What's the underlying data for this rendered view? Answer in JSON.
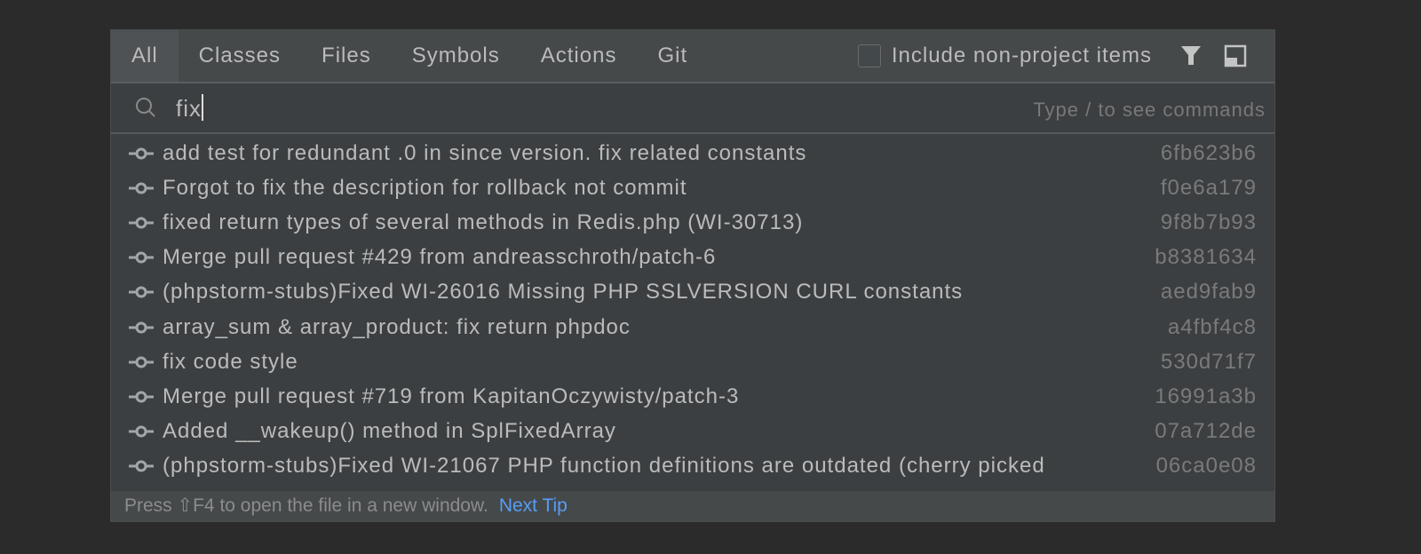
{
  "tabs": [
    {
      "label": "All",
      "selected": true
    },
    {
      "label": "Classes"
    },
    {
      "label": "Files"
    },
    {
      "label": "Symbols"
    },
    {
      "label": "Actions"
    },
    {
      "label": "Git"
    }
  ],
  "options": {
    "include_label": "Include non-project items",
    "include_checked": false,
    "filter_icon": "filter-icon",
    "pin_icon": "open-in-window-icon"
  },
  "search": {
    "value": "fix",
    "hint": "Type / to see commands",
    "icon": "search-icon"
  },
  "results": [
    {
      "message": "add test for redundant .0 in since version. fix related constants",
      "hash": "6fb623b6"
    },
    {
      "message": "Forgot to fix the description for rollback not commit",
      "hash": "f0e6a179"
    },
    {
      "message": "fixed return types of several methods in Redis.php (WI-30713)",
      "hash": "9f8b7b93"
    },
    {
      "message": "Merge pull request #429 from andreasschroth/patch-6",
      "hash": "b8381634"
    },
    {
      "message": "(phpstorm-stubs)Fixed WI-26016 Missing PHP SSLVERSION CURL constants",
      "hash": "aed9fab9"
    },
    {
      "message": "array_sum & array_product: fix return phpdoc",
      "hash": "a4fbf4c8"
    },
    {
      "message": "fix code style",
      "hash": "530d71f7"
    },
    {
      "message": "Merge pull request #719 from KapitanOczywisty/patch-3",
      "hash": "16991a3b"
    },
    {
      "message": "Added __wakeup() method in SplFixedArray",
      "hash": "07a712de"
    },
    {
      "message": "(phpstorm-stubs)Fixed WI-21067 PHP function definitions are outdated (cherry picked",
      "hash": "06ca0e08"
    }
  ],
  "footer": {
    "text": "Press ⇧F4 to open the file in a new window.",
    "link": "Next Tip"
  }
}
